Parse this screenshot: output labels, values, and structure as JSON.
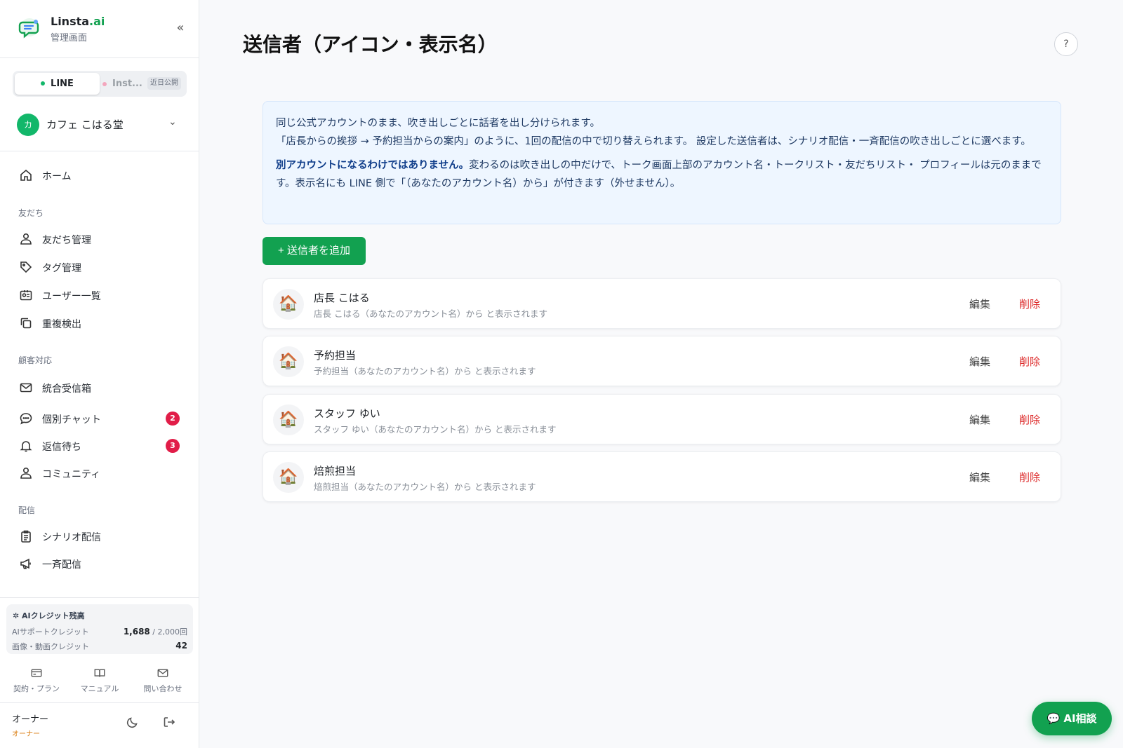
{
  "brand": {
    "name": "Linsta",
    "name_suffix": ".ai",
    "subtitle": "管理画面"
  },
  "channels": {
    "line": "LINE",
    "instagram": "Inst...",
    "soon_badge": "近日公開"
  },
  "account": {
    "avatar_letter": "カ",
    "name": "カフェ こはる堂"
  },
  "nav": {
    "home": "ホーム",
    "section_friends": "友だち",
    "friends_manage": "友だち管理",
    "tags": "タグ管理",
    "users": "ユーザー一覧",
    "duplicates": "重複検出",
    "section_support": "顧客対応",
    "inbox": "統合受信箱",
    "chat": "個別チャット",
    "chat_badge": "2",
    "waiting": "返信待ち",
    "waiting_badge": "3",
    "community": "コミュニティ",
    "section_delivery": "配信",
    "scenario": "シナリオ配信",
    "broadcast": "一斉配信"
  },
  "credits": {
    "title": "AIクレジット残高",
    "support_label": "AIサポートクレジット",
    "support_value": "1,688",
    "support_total": "/ 2,000回",
    "media_label": "画像・動画クレジット",
    "media_value": "42"
  },
  "footer": {
    "plan": "契約・プラン",
    "manual": "マニュアル",
    "contact": "問い合わせ"
  },
  "owner": {
    "name": "オーナー",
    "role": "オーナー"
  },
  "page": {
    "title": "送信者（アイコン・表示名）",
    "help": "?"
  },
  "info": {
    "line1": "同じ公式アカウントのまま、吹き出しごとに話者を出し分けられます。",
    "line2": "「店長からの挨拶 → 予約担当からの案内」のように、1回の配信の中で切り替えられます。 設定した送信者は、シナリオ配信・一斉配信の吹き出しごとに選べます。",
    "bold": "別アカウントになるわけではありません。",
    "line3": "変わるのは吹き出しの中だけで、トーク画面上部のアカウント名・トークリスト・友だちリスト・ プロフィールは元のままです。表示名にも LINE 側で「（あなたのアカウント名）から」が付きます（外せません）。"
  },
  "add_button": "+ 送信者を追加",
  "senders": [
    {
      "name": "店長 こはる",
      "sub": "店長 こはる（あなたのアカウント名）から と表示されます",
      "edit": "編集",
      "delete": "削除"
    },
    {
      "name": "予約担当",
      "sub": "予約担当（あなたのアカウント名）から と表示されます",
      "edit": "編集",
      "delete": "削除"
    },
    {
      "name": "スタッフ ゆい",
      "sub": "スタッフ ゆい（あなたのアカウント名）から と表示されます",
      "edit": "編集",
      "delete": "削除"
    },
    {
      "name": "焙煎担当",
      "sub": "焙煎担当（あなたのアカウント名）から と表示されます",
      "edit": "編集",
      "delete": "削除"
    }
  ],
  "ai_button": "AI相談",
  "colors": {
    "accent": "#12a150",
    "danger": "#dc2626",
    "badge": "#e11d48",
    "info_bg": "#eef6ff"
  }
}
